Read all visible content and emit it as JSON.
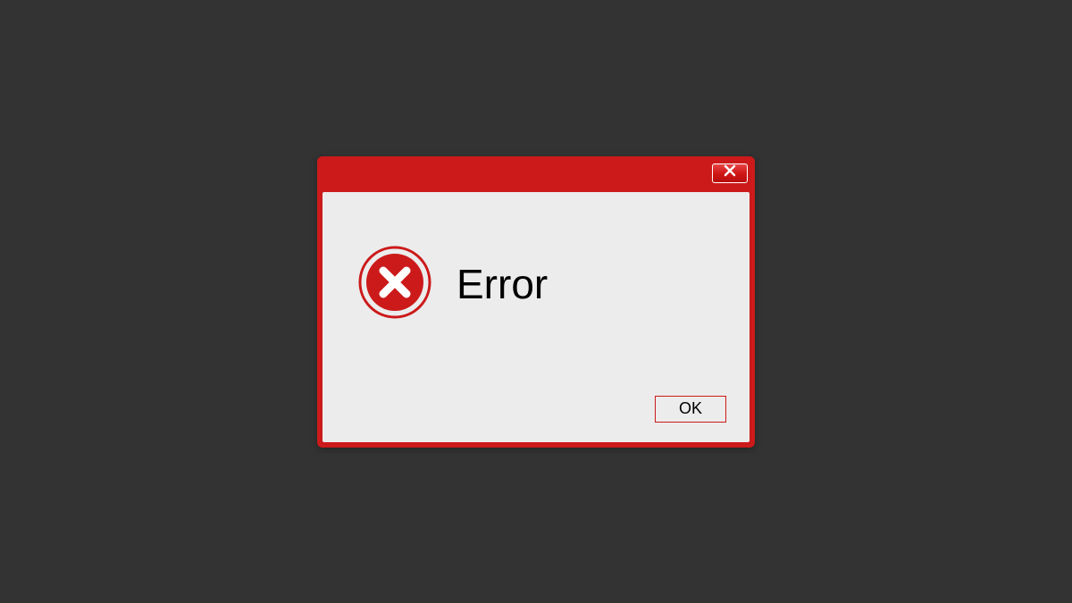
{
  "dialog": {
    "message": "Error",
    "ok_label": "OK"
  },
  "colors": {
    "frame": "#cc1a1a",
    "body": "#ececec",
    "background": "#333333"
  },
  "icons": {
    "close": "close-icon",
    "error": "error-x-icon"
  }
}
